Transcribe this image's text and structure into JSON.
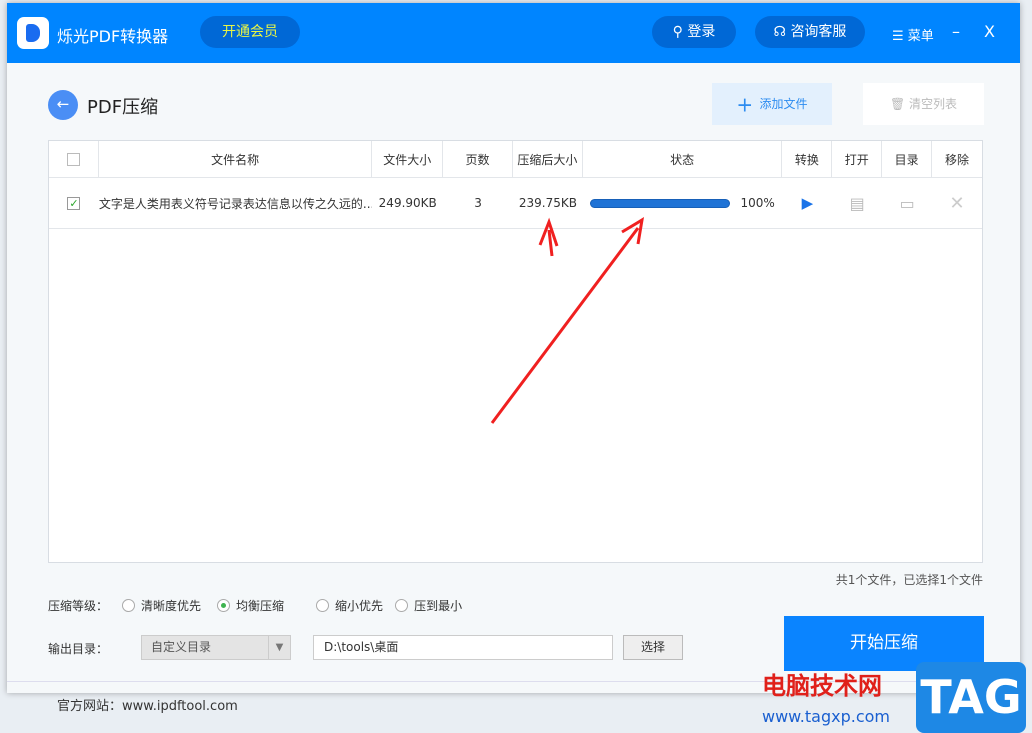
{
  "header": {
    "app_name": "烁光PDF转换器",
    "vip": "开通会员",
    "login": "登录",
    "support": "咨询客服",
    "menu": "菜单",
    "minimize": "–",
    "close": "X"
  },
  "toolbar": {
    "title": "PDF压缩",
    "add": "添加文件",
    "clear": "清空列表"
  },
  "table": {
    "columns": [
      "文件名称",
      "文件大小",
      "页数",
      "压缩后大小",
      "状态",
      "转换",
      "打开",
      "目录",
      "移除"
    ],
    "rows": [
      {
        "name": "文字是人类用表义符号记录表达信息以传之久远的...",
        "size": "249.90KB",
        "pages": "3",
        "compressed": "239.75KB",
        "progress": 100,
        "progress_label": "100%",
        "checked": true
      }
    ]
  },
  "summary": "共1个文件，已选择1个文件",
  "level": {
    "label": "压缩等级：",
    "options": [
      "清晰度优先",
      "均衡压缩",
      "缩小优先",
      "压到最小"
    ],
    "selected": "均衡压缩"
  },
  "output": {
    "label": "输出目录：",
    "mode": "自定义目录",
    "path": "D:\\tools\\桌面",
    "choose": "选择"
  },
  "start": "开始压缩",
  "website": "官方网站：www.ipdftool.com",
  "watermark": {
    "cn": "电脑技术网",
    "url": "www.tagxp.com",
    "tag": "TAG"
  },
  "colors": {
    "header": "#0085ff",
    "accent": "#0a84ff",
    "vip": "#e8f545"
  }
}
